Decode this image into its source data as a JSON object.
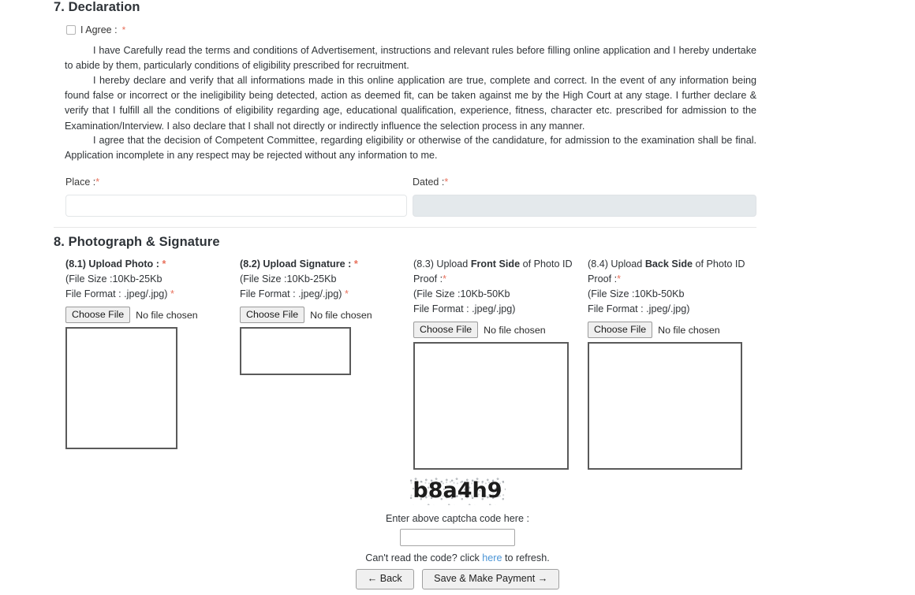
{
  "sections": {
    "declaration": {
      "heading": "7. Declaration",
      "agree_label": "I Agree :",
      "required_mark": "*",
      "paragraphs": [
        "I have Carefully read the terms and conditions of Advertisement, instructions and relevant rules before filling online application and I hereby undertake to abide by them, particularly conditions of eligibility prescribed for recruitment.",
        "I hereby declare and verify that all informations made in this online application are true, complete and correct. In the event of any information being found false or incorrect or the ineligibility being detected, action as deemed fit, can be taken against me by the High Court at any stage. I further declare & verify that I fulfill all the conditions of eligibility regarding age, educational qualification, experience, fitness, character etc. prescribed for admission to the Examination/Interview. I also declare that I shall not directly or indirectly influence the selection process in any manner.",
        "I agree that the decision of Competent Committee, regarding eligibility or otherwise of the candidature, for admission to the examination shall be final. Application incomplete in any respect may be rejected without any information to me."
      ],
      "place_label": "Place :",
      "place_value": "",
      "dated_label": "Dated :",
      "dated_value": ""
    },
    "photograph": {
      "heading": "8. Photograph & Signature",
      "uploads": [
        {
          "title_prefix": "(8.1) Upload Photo : ",
          "title_bold": "",
          "title_suffix": "",
          "required": "*",
          "size_line": "(File Size :10Kb-25Kb",
          "format_line": "File Format : .jpeg/.jpg) ",
          "format_required": "*",
          "button_label": "Choose File",
          "file_status": "No file chosen"
        },
        {
          "title_prefix": "(8.2) Upload Signature : ",
          "title_bold": "",
          "title_suffix": "",
          "required": "*",
          "size_line": "(File Size :10Kb-25Kb",
          "format_line": "File Format : .jpeg/.jpg) ",
          "format_required": "*",
          "button_label": "Choose File",
          "file_status": "No file chosen"
        },
        {
          "title_prefix": "(8.3) Upload ",
          "title_bold": "Front Side",
          "title_suffix": " of Photo ID Proof :",
          "required": "*",
          "size_line": "(File Size :10Kb-50Kb",
          "format_line": "File Format : .jpeg/.jpg)",
          "format_required": "",
          "button_label": "Choose File",
          "file_status": "No file chosen"
        },
        {
          "title_prefix": "(8.4) Upload ",
          "title_bold": "Back Side",
          "title_suffix": " of Photo ID Proof :",
          "required": "*",
          "size_line": "(File Size :10Kb-50Kb",
          "format_line": "File Format : .jpeg/.jpg)",
          "format_required": "",
          "button_label": "Choose File",
          "file_status": "No file chosen"
        }
      ]
    },
    "captcha": {
      "code": "b8a4h9",
      "prompt": "Enter above captcha code here :",
      "input_value": "",
      "refresh_prefix": "Can't read the code? click ",
      "refresh_link": "here",
      "refresh_suffix": " to refresh."
    },
    "footer": {
      "back_label": "← Back",
      "submit_label": "Save & Make Payment →"
    }
  },
  "colors": {
    "required_red": "#e8705b",
    "link_blue": "#4a94d6",
    "disabled_field": "#e4e9ec",
    "preview_border": "#5a5a5a"
  }
}
